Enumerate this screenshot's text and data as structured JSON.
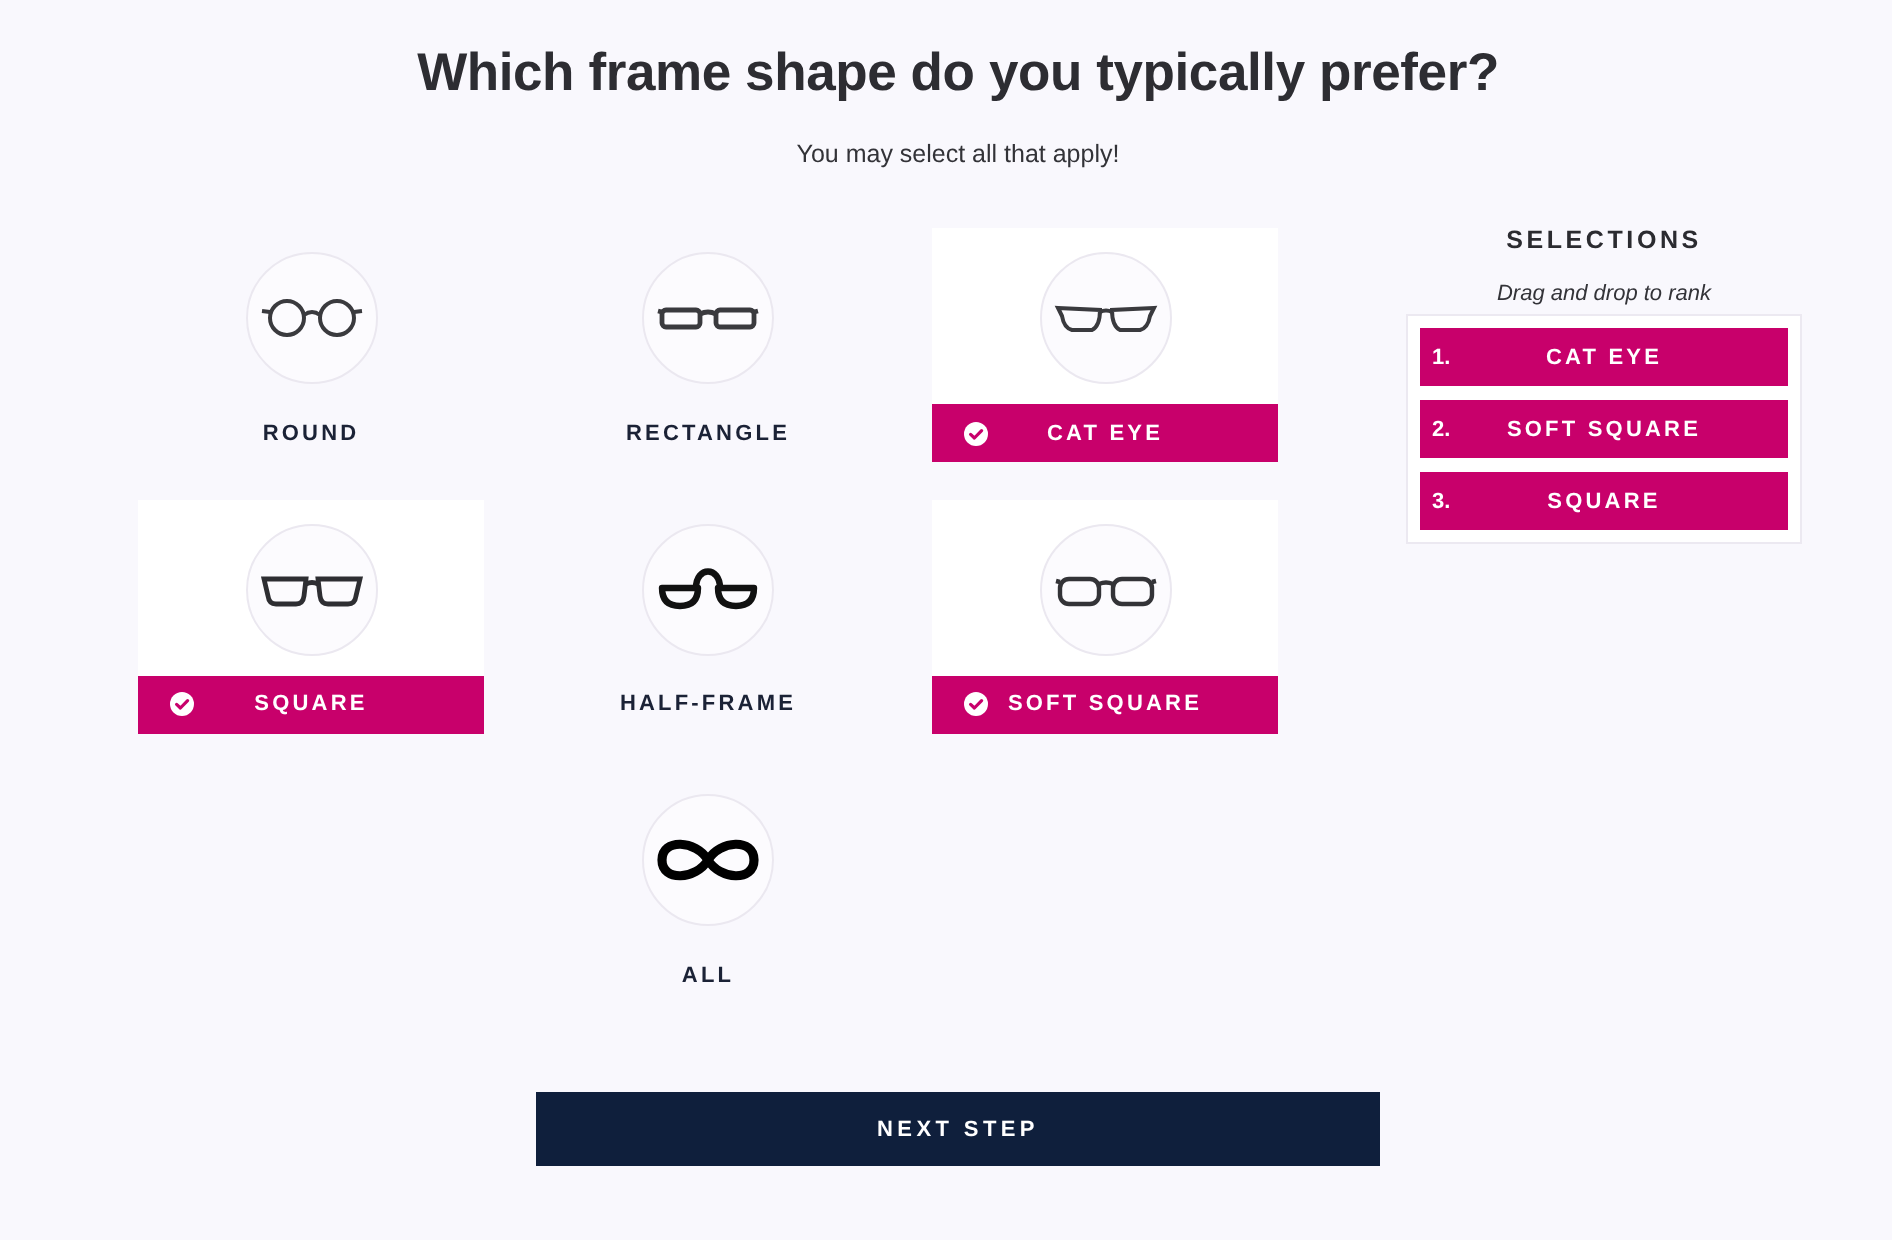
{
  "heading": "Which frame shape do you typically prefer?",
  "subheading": "You may select all that apply!",
  "shapes": [
    {
      "label": "ROUND",
      "kind": "round",
      "selected": false
    },
    {
      "label": "RECTANGLE",
      "kind": "rectangle",
      "selected": false
    },
    {
      "label": "CAT EYE",
      "kind": "cateye",
      "selected": true
    },
    {
      "label": "SQUARE",
      "kind": "square",
      "selected": true
    },
    {
      "label": "HALF-FRAME",
      "kind": "halfframe",
      "selected": false
    },
    {
      "label": "SOFT SQUARE",
      "kind": "softsquare",
      "selected": true
    },
    {
      "label": "ALL",
      "kind": "all",
      "selected": false
    }
  ],
  "selections": {
    "title": "SELECTIONS",
    "hint": "Drag and drop to rank",
    "items": [
      {
        "rank": "1.",
        "label": "CAT EYE"
      },
      {
        "rank": "2.",
        "label": "SOFT SQUARE"
      },
      {
        "rank": "3.",
        "label": "SQUARE"
      }
    ]
  },
  "next_button": "NEXT STEP"
}
